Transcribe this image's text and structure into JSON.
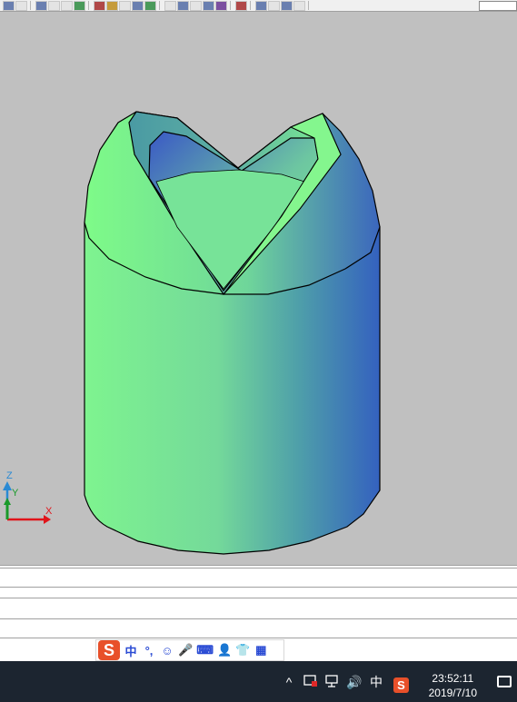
{
  "toolbar": {
    "groups": [
      [
        "qnew-icon",
        "qsave-icon"
      ],
      [
        "zoom-realtime-icon",
        "pan-icon",
        "orbit-icon",
        "named-views-icon"
      ],
      [
        "cursor-icon",
        "layer-icon",
        "properties-icon",
        "match-icon",
        "undo-icon"
      ],
      [
        "ucs-icon",
        "box-icon",
        "sphere-icon",
        "cylinder-icon",
        "render-icon"
      ],
      [
        "layout-icon"
      ],
      [
        "zoom-window-icon",
        "zoom-prev-icon",
        "zoom-all-icon",
        "display-icon"
      ]
    ]
  },
  "viewport": {
    "background": "#c0c0c0",
    "ucs": {
      "z_label": "Z",
      "y_label": "Y",
      "x_label": "X"
    }
  },
  "ime_bar": {
    "logo": "S",
    "items": [
      {
        "name": "chinese-mode-icon",
        "text": "中"
      },
      {
        "name": "punctuation-icon",
        "text": "°,"
      },
      {
        "name": "emoji-icon",
        "text": "☺"
      },
      {
        "name": "microphone-icon",
        "text": "🎤"
      },
      {
        "name": "keyboard-icon",
        "text": "⌨"
      },
      {
        "name": "user-icon",
        "text": "👤"
      },
      {
        "name": "skin-icon",
        "text": "👕"
      },
      {
        "name": "toolbox-icon",
        "text": "▦"
      }
    ]
  },
  "taskbar": {
    "tray": {
      "chevron": "^",
      "sound": "🔊",
      "ime_mode": "中",
      "sogou": "S"
    },
    "clock": {
      "time": "23:52:11",
      "date": "2019/7/10"
    }
  },
  "colors": {
    "solid_light": "#7ef78c",
    "solid_mid": "#5fb5a6",
    "solid_dark": "#3461bf",
    "taskbar": "#1c2530",
    "sogou": "#e8502a"
  }
}
